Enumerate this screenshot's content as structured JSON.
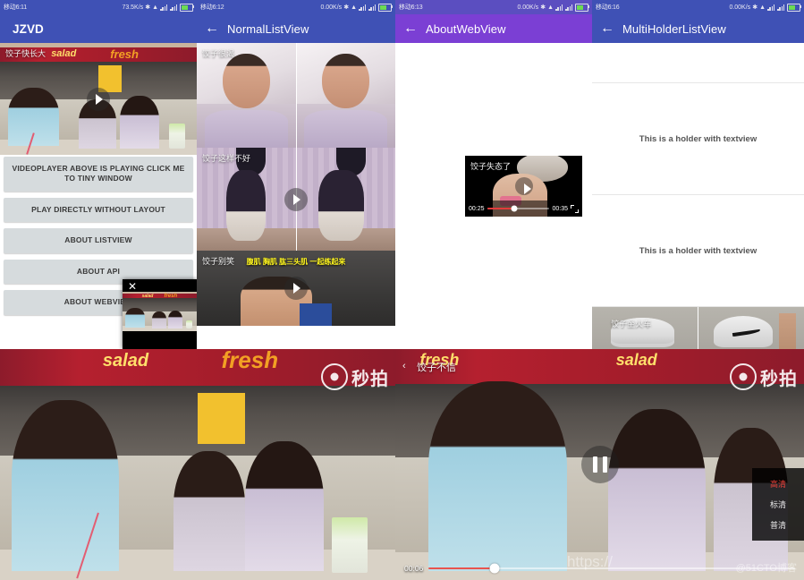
{
  "app": {
    "accent_blue": "#3f51b5",
    "accent_purple": "#7b3fd4",
    "button_grey": "#d6dbdd"
  },
  "panels": [
    {
      "id": "jzvd-home",
      "status": {
        "carrier": "移动6:11",
        "speed": "73.5K/s",
        "bluetooth": "bt-icon",
        "wifi": "wifi-icon",
        "signal": "signal-icon",
        "battery": "battery-icon"
      },
      "appbar": {
        "title": "JZVD",
        "has_back": false
      },
      "video": {
        "caption": "饺子快长大",
        "play": "play-icon"
      },
      "buttons": [
        "VIDEOPLAYER ABOVE IS PLAYING CLICK ME TO TINY WINDOW",
        "PLAY DIRECTLY WITHOUT LAYOUT",
        "ABOUT LISTVIEW",
        "ABOUT API",
        "ABOUT WEBVIEW"
      ],
      "tiny_window": {
        "close": "✕"
      }
    },
    {
      "id": "normal-listview",
      "status": {
        "carrier": "移动6:12",
        "speed": "0.00K/s"
      },
      "appbar": {
        "title": "NormalListView",
        "has_back": true,
        "back": "←"
      },
      "items": [
        {
          "caption": "饺子很渴",
          "play": false
        },
        {
          "caption": "饺子这样不好",
          "play": true
        },
        {
          "caption": "饺子别笑",
          "subtitle": "腹肌 胸肌 肱三头肌 一起练起来",
          "play": true
        }
      ]
    },
    {
      "id": "about-webview",
      "status": {
        "carrier": "移动6:13",
        "speed": "0.00K/s"
      },
      "appbar": {
        "title": "AboutWebView",
        "has_back": true,
        "back": "←"
      },
      "player": {
        "caption": "饺子失态了",
        "current_time": "00:25",
        "total_time": "00:35",
        "play": "play-icon",
        "fullscreen": "fullscreen-icon"
      }
    },
    {
      "id": "multiholder-listview",
      "status": {
        "carrier": "移动6:16",
        "speed": "0.00K/s"
      },
      "appbar": {
        "title": "MultiHolderListView",
        "has_back": true,
        "back": "←"
      },
      "holders": [
        {
          "type": "blank",
          "text": ""
        },
        {
          "type": "text",
          "text": "This is a holder with textview"
        },
        {
          "type": "text",
          "text": "This is a holder with textview"
        },
        {
          "type": "video",
          "text": "饺子坐火车"
        }
      ]
    }
  ],
  "fullscreen_left": {
    "id": "fullscreen-player-left",
    "watermark": "秒拍",
    "watermark_icon": "miaopai-logo-icon"
  },
  "fullscreen_right": {
    "id": "fullscreen-player-right",
    "back": "‹",
    "title": "饺子不信",
    "watermark": "秒拍",
    "watermark_icon": "miaopai-logo-icon",
    "pause": "pause-icon",
    "current_time": "00:06",
    "quality_menu": {
      "options": [
        "高清",
        "标清",
        "普清"
      ],
      "selected": "高清"
    },
    "url_watermark": "https://",
    "site_watermark": "@51CTO博客"
  }
}
